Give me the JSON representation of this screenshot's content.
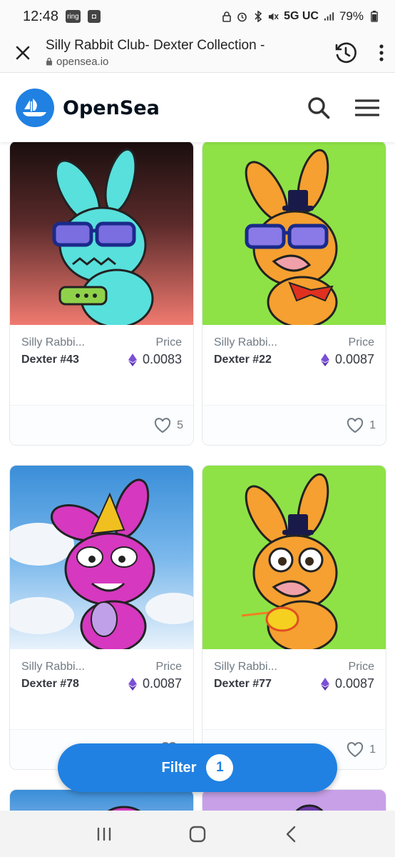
{
  "status_bar": {
    "time": "12:48",
    "notif_ring": "ring",
    "network": "5G UC",
    "battery": "79%"
  },
  "browser": {
    "title": "Silly Rabbit Club- Dexter Collection -",
    "url": "opensea.io",
    "icons": [
      "close-icon",
      "lock-icon",
      "history-icon",
      "more-vert-icon"
    ]
  },
  "header": {
    "brand": "OpenSea",
    "icons": [
      "opensea-logo-icon",
      "search-icon",
      "menu-icon"
    ]
  },
  "cards": [
    {
      "collection": "Silly Rabbi...",
      "name": "Dexter #43",
      "price_label": "Price",
      "price": "0.0083",
      "likes": "5"
    },
    {
      "collection": "Silly Rabbi...",
      "name": "Dexter #22",
      "price_label": "Price",
      "price": "0.0087",
      "likes": "1"
    },
    {
      "collection": "Silly Rabbi...",
      "name": "Dexter #78",
      "price_label": "Price",
      "price": "0.0087",
      "likes": ""
    },
    {
      "collection": "Silly Rabbi...",
      "name": "Dexter #77",
      "price_label": "Price",
      "price": "0.0087",
      "likes": "1"
    }
  ],
  "filter": {
    "label": "Filter",
    "count": "1"
  },
  "colors": {
    "brand_blue": "#2081e2",
    "eth_purple": "#7b4fd6"
  }
}
